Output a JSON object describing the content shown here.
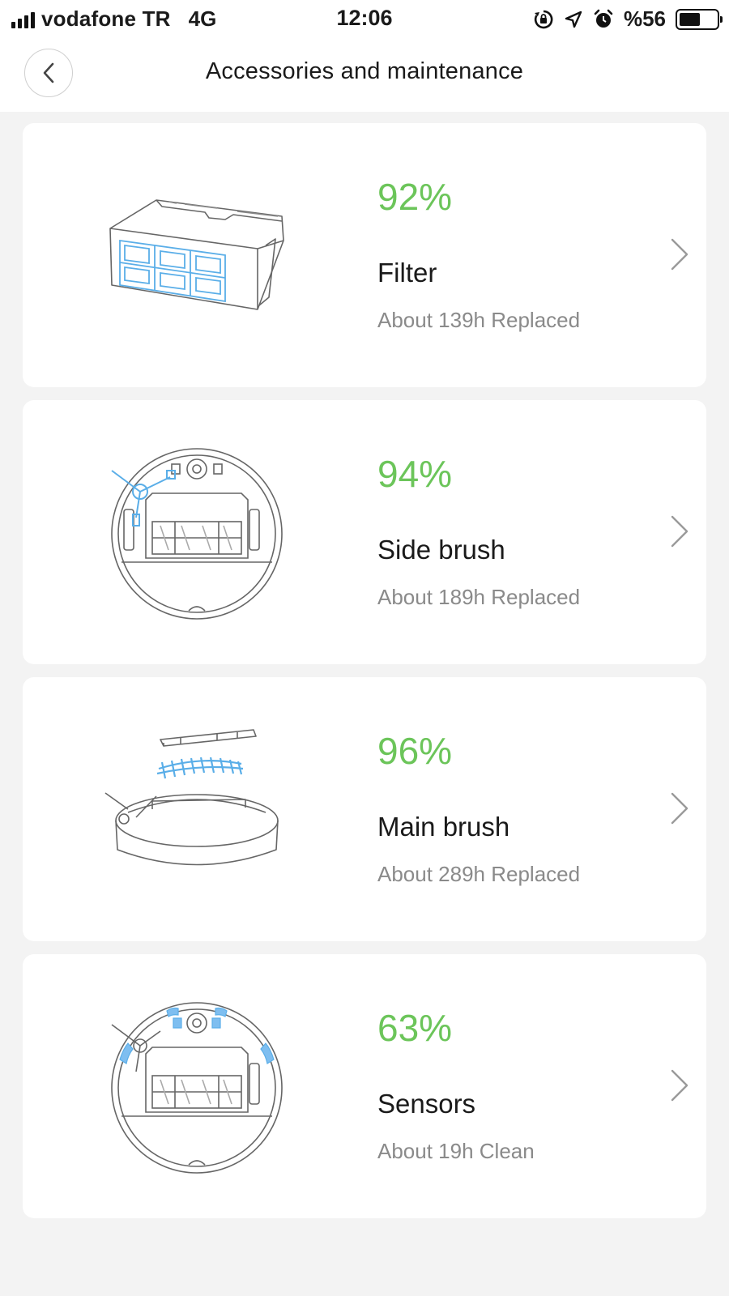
{
  "status_bar": {
    "carrier": "vodafone TR",
    "network": "4G",
    "time": "12:06",
    "battery_pct": "%56",
    "battery_level": 0.56,
    "icons": [
      "rotation-lock-icon",
      "location-icon",
      "alarm-icon"
    ]
  },
  "header": {
    "title": "Accessories and maintenance",
    "back_icon": "chevron-left-icon"
  },
  "colors": {
    "accent_green": "#6cc55a",
    "illustration_blue": "#5aaee8",
    "secondary_text": "#8a8a8a",
    "background": "#f3f3f3"
  },
  "items": [
    {
      "percent": "92%",
      "name": "Filter",
      "subtitle": "About 139h Replaced",
      "illustration": "filter-illustration"
    },
    {
      "percent": "94%",
      "name": "Side brush",
      "subtitle": "About 189h Replaced",
      "illustration": "side-brush-illustration"
    },
    {
      "percent": "96%",
      "name": "Main brush",
      "subtitle": "About 289h Replaced",
      "illustration": "main-brush-illustration"
    },
    {
      "percent": "63%",
      "name": "Sensors",
      "subtitle": "About 19h Clean",
      "illustration": "sensors-illustration"
    }
  ]
}
